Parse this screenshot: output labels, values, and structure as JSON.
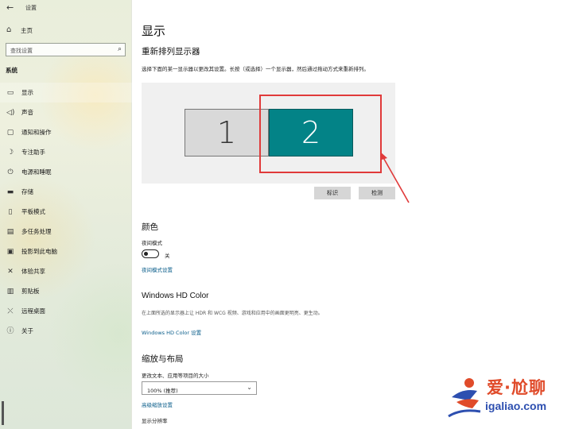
{
  "window": {
    "title": "设置"
  },
  "sidebar": {
    "home_label": "主页",
    "search_placeholder": "查找设置",
    "section_label": "系统",
    "items": [
      {
        "label": "显示",
        "icon": "monitor-icon"
      },
      {
        "label": "声音",
        "icon": "speaker-icon"
      },
      {
        "label": "通知和操作",
        "icon": "notification-icon"
      },
      {
        "label": "专注助手",
        "icon": "moon-icon"
      },
      {
        "label": "电源和睡眠",
        "icon": "power-icon"
      },
      {
        "label": "存储",
        "icon": "storage-icon"
      },
      {
        "label": "平板模式",
        "icon": "tablet-icon"
      },
      {
        "label": "多任务处理",
        "icon": "multitask-icon"
      },
      {
        "label": "投影到此电脑",
        "icon": "project-icon"
      },
      {
        "label": "体验共享",
        "icon": "share-icon"
      },
      {
        "label": "剪贴板",
        "icon": "clipboard-icon"
      },
      {
        "label": "远程桌面",
        "icon": "remote-icon"
      },
      {
        "label": "关于",
        "icon": "info-icon"
      }
    ]
  },
  "main": {
    "title": "显示",
    "rearrange": {
      "heading": "重新排列显示器",
      "description": "选择下面的某一显示器以更改其设置。长按（或选择）一个显示器，然后通过拖动方式来重新排列。",
      "monitor_1": "1",
      "monitor_2": "2",
      "identify_label": "标识",
      "detect_label": "检测"
    },
    "color": {
      "heading": "颜色",
      "night_mode_label": "夜间模式",
      "toggle_state": "关",
      "night_settings_link": "夜间模式设置"
    },
    "hd_color": {
      "heading": "Windows HD Color",
      "description": "在上面所选的显示器上让 HDR 和 WCG 视频、游戏和应用中的画面更明亮、更生动。",
      "link": "Windows HD Color 设置"
    },
    "scale": {
      "heading": "缩放与布局",
      "scale_label": "更改文本、应用等项目的大小",
      "scale_value": "100% (推荐)",
      "advanced_link": "高级缩放设置",
      "resolution_label": "显示分辨率"
    }
  },
  "watermark": {
    "top": "爱·尬聊",
    "bottom": "igaliao.com"
  },
  "colors": {
    "accent": "#038387",
    "highlight": "#e03a3a",
    "link": "#0a5d8a"
  }
}
